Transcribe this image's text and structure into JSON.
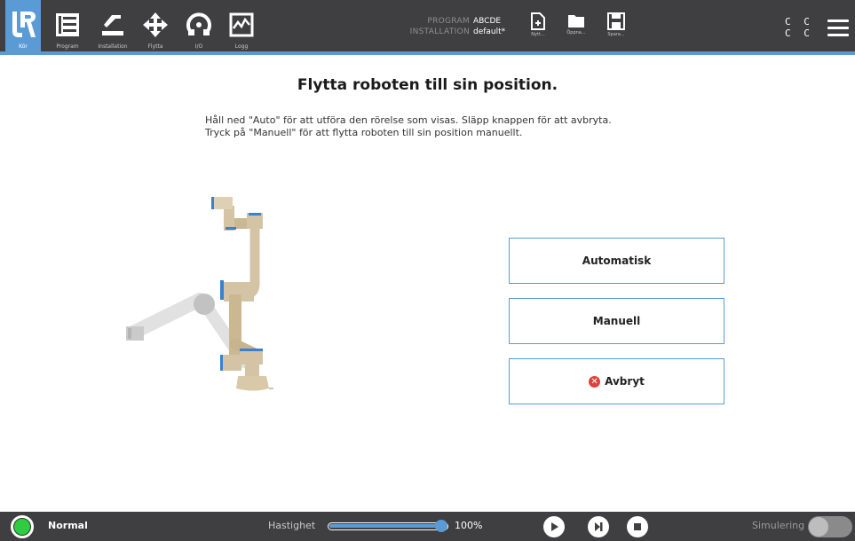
{
  "topbar": {
    "nav": [
      {
        "id": "run",
        "label": "Kör",
        "icon": "ur-logo-icon"
      },
      {
        "id": "program",
        "label": "Program",
        "icon": "program-icon"
      },
      {
        "id": "installation",
        "label": "Installation",
        "icon": "installation-icon"
      },
      {
        "id": "move",
        "label": "Flytta",
        "icon": "move-icon"
      },
      {
        "id": "io",
        "label": "I/O",
        "icon": "io-icon"
      },
      {
        "id": "log",
        "label": "Logg",
        "icon": "log-icon"
      }
    ],
    "program_key": "PROGRAM",
    "program_value": "ABCDE",
    "installation_key": "INSTALLATION",
    "installation_value": "default*",
    "file": [
      {
        "id": "new",
        "label": "Nytt...",
        "icon": "new-file-icon"
      },
      {
        "id": "open",
        "label": "Öppna...",
        "icon": "open-folder-icon"
      },
      {
        "id": "save",
        "label": "Spara...",
        "icon": "save-icon"
      }
    ],
    "cc_row1": "C C",
    "cc_row2": "C C",
    "accent_color": "#5b9bd5",
    "bar_color": "#3f3f41"
  },
  "main": {
    "title": "Flytta roboten till sin position.",
    "instruction_line1": "Håll ned \"Auto\" för att utföra den rörelse som visas. Släpp knappen för att avbryta.",
    "instruction_line2": "Tryck på \"Manuell\" för att flytta roboten till sin position manuellt.",
    "buttons": {
      "auto": "Automatisk",
      "manual": "Manuell",
      "cancel": "Avbryt"
    }
  },
  "bottombar": {
    "status": "Normal",
    "status_color": "#2ecc40",
    "speed_label": "Hastighet",
    "speed_value": "100%",
    "speed_fraction": 1.0,
    "simulation_label": "Simulering",
    "simulation_on": false
  }
}
